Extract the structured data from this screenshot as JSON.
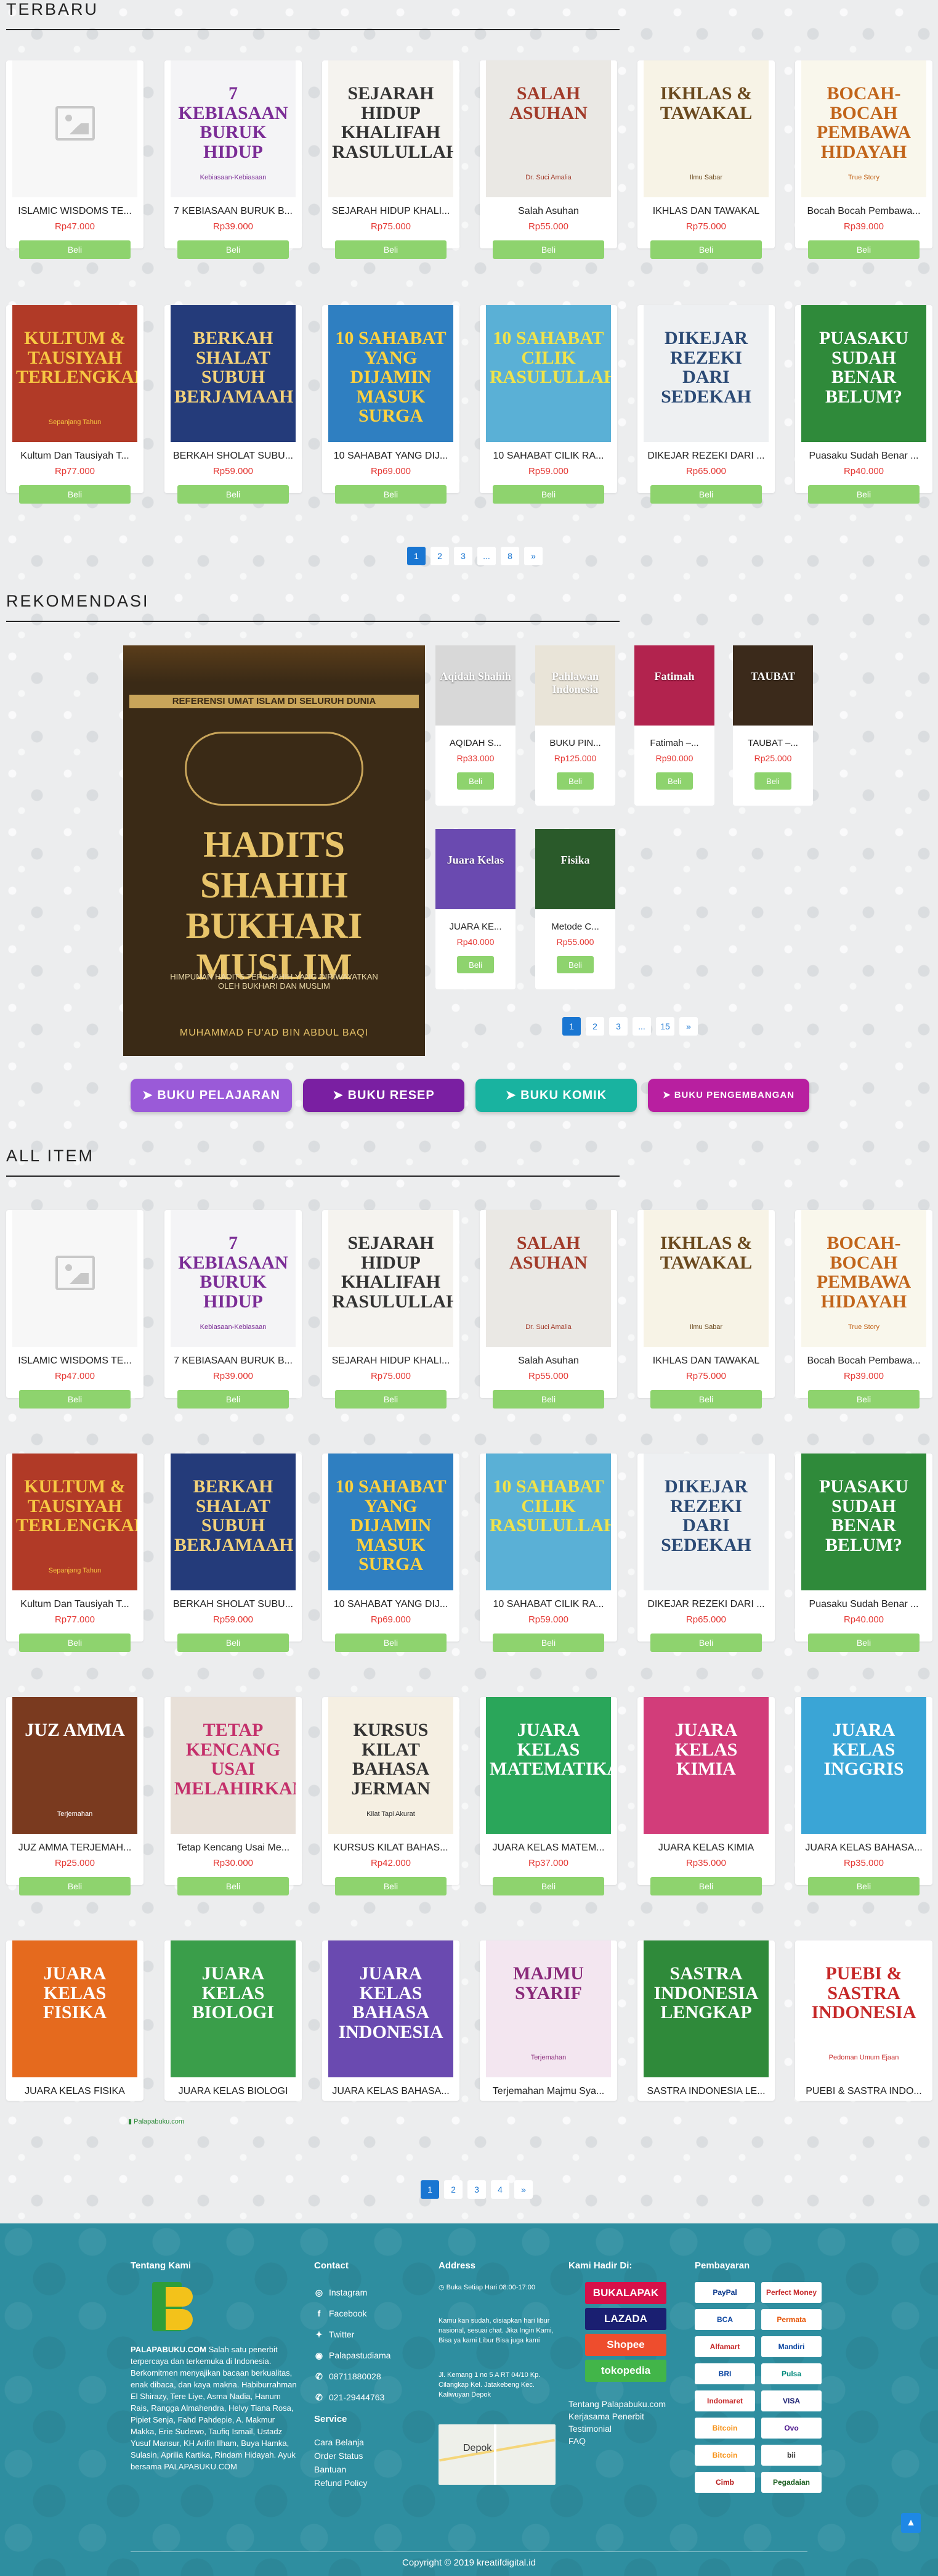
{
  "sections": {
    "newest": "TERBARU",
    "recommended": "REKOMENDASI",
    "all_items": "ALL ITEM"
  },
  "buy_label": "Beli",
  "books": [
    {
      "title": "ISLAMIC WISDOMS TE...",
      "price": "Rp47.000"
    },
    {
      "title": "7 KEBIASAAN BURUK B...",
      "price": "Rp39.000"
    },
    {
      "title": "SEJARAH HIDUP KHALI...",
      "price": "Rp75.000"
    },
    {
      "title": "Salah Asuhan",
      "price": "Rp55.000"
    },
    {
      "title": "IKHLAS DAN TAWAKAL",
      "price": "Rp75.000"
    },
    {
      "title": "Bocah Bocah Pembawa...",
      "price": "Rp39.000"
    },
    {
      "title": "Kultum Dan Tausiyah T...",
      "price": "Rp77.000"
    },
    {
      "title": "BERKAH SHOLAT SUBU...",
      "price": "Rp59.000"
    },
    {
      "title": "10 SAHABAT YANG DIJ...",
      "price": "Rp69.000"
    },
    {
      "title": "10 SAHABAT CILIK RA...",
      "price": "Rp59.000"
    },
    {
      "title": "DIKEJAR REZEKI DARI ...",
      "price": "Rp65.000"
    },
    {
      "title": "Puasaku Sudah Benar ...",
      "price": "Rp40.000"
    }
  ],
  "more_books": [
    {
      "title": "JUZ AMMA TERJEMAH...",
      "price": "Rp25.000"
    },
    {
      "title": "Tetap Kencang Usai Me...",
      "price": "Rp30.000"
    },
    {
      "title": "KURSUS KILAT BAHAS...",
      "price": "Rp42.000"
    },
    {
      "title": "JUARA KELAS MATEM...",
      "price": "Rp37.000"
    },
    {
      "title": "JUARA KELAS KIMIA",
      "price": "Rp35.000"
    },
    {
      "title": "JUARA KELAS BAHASA...",
      "price": "Rp35.000"
    },
    {
      "title": "JUARA KELAS FISIKA",
      "price": ""
    },
    {
      "title": "JUARA KELAS BIOLOGI",
      "price": ""
    },
    {
      "title": "JUARA KELAS BAHASA...",
      "price": ""
    },
    {
      "title": "Terjemahan Majmu Sya...",
      "price": ""
    },
    {
      "title": "SASTRA INDONESIA LE...",
      "price": ""
    },
    {
      "title": "PUEBI & SASTRA INDO...",
      "price": ""
    }
  ],
  "covers": [
    {
      "t": "",
      "s": "",
      "bg": "#f7f7f7",
      "fg": "#999",
      "ph": true
    },
    {
      "t": "7 kebiasaan buruk hidup",
      "s": "Kebiasaan-Kebiasaan",
      "bg": "#f4f4f6",
      "fg": "#7b2d96"
    },
    {
      "t": "Sejarah Hidup Khalifah Rasulullah",
      "s": "",
      "bg": "#f5f3ef",
      "fg": "#333"
    },
    {
      "t": "Salah Asuhan",
      "s": "Dr. Suci Amalia",
      "bg": "#eae8e4",
      "fg": "#a23b2a"
    },
    {
      "t": "Ikhlas & Tawakal",
      "s": "Ilmu Sabar",
      "bg": "#f7f3e6",
      "fg": "#6b4a1f"
    },
    {
      "t": "Bocah-Bocah Pembawa Hidayah",
      "s": "True Story",
      "bg": "#f9f7ec",
      "fg": "#c2651b"
    },
    {
      "t": "Kultum & Tausiyah Terlengkap",
      "s": "Sepanjang Tahun",
      "bg": "#b13a27",
      "fg": "#f7c843"
    },
    {
      "t": "Berkah Shalat Subuh Berjamaah",
      "s": "",
      "bg": "#243b7a",
      "fg": "#f3d27a"
    },
    {
      "t": "10 Sahabat yang Dijamin Masuk Surga",
      "s": "",
      "bg": "#2f7fc1",
      "fg": "#ffd23f"
    },
    {
      "t": "10 Sahabat Cilik Rasulullah",
      "s": "",
      "bg": "#5ab0d6",
      "fg": "#f0e34a"
    },
    {
      "t": "Dikejar Rezeki dari Sedekah",
      "s": "",
      "bg": "#eef0f2",
      "fg": "#2b4a75"
    },
    {
      "t": "Puasaku Sudah Benar Belum?",
      "s": "",
      "bg": "#2f8a3a",
      "fg": "#fff"
    }
  ],
  "more_covers": [
    {
      "t": "Juz Amma",
      "s": "Terjemahan",
      "bg": "#7a3a1f",
      "fg": "#fff"
    },
    {
      "t": "Tetap Kencang Usai Melahirkan",
      "s": "",
      "bg": "#e8e0d8",
      "fg": "#c4306b"
    },
    {
      "t": "Kursus Kilat Bahasa Jerman",
      "s": "Kilat Tapi Akurat",
      "bg": "#f5efe2",
      "fg": "#333"
    },
    {
      "t": "Juara Kelas Matematika",
      "s": "",
      "bg": "#2aa65a",
      "fg": "#fff"
    },
    {
      "t": "Juara Kelas Kimia",
      "s": "",
      "bg": "#d23d7a",
      "fg": "#fff"
    },
    {
      "t": "Juara Kelas Inggris",
      "s": "",
      "bg": "#3aa5d6",
      "fg": "#fff"
    },
    {
      "t": "Juara Kelas Fisika",
      "s": "",
      "bg": "#e56a1e",
      "fg": "#fff"
    },
    {
      "t": "Juara Kelas Biologi",
      "s": "",
      "bg": "#3a9e4a",
      "fg": "#fff"
    },
    {
      "t": "Juara Kelas Bahasa Indonesia",
      "s": "",
      "bg": "#6a4ab0",
      "fg": "#fff"
    },
    {
      "t": "Majmu Syarif",
      "s": "Terjemahan",
      "bg": "#f3e6f0",
      "fg": "#8a2a7a"
    },
    {
      "t": "Sastra Indonesia Lengkap",
      "s": "",
      "bg": "#2f8a3a",
      "fg": "#fff"
    },
    {
      "t": "PUEBI & Sastra Indonesia",
      "s": "Pedoman Umum Ejaan",
      "bg": "#fff",
      "fg": "#c62828"
    }
  ],
  "pagination_newest": [
    "1",
    "2",
    "3",
    "...",
    "8",
    "»"
  ],
  "pagination_rec": [
    "1",
    "2",
    "3",
    "...",
    "15",
    "»"
  ],
  "pagination_all": [
    "1",
    "2",
    "3",
    "4",
    "»"
  ],
  "recommend": {
    "feature": {
      "title": "HADITS SHAHIH BUKHARI MUSLIM",
      "top": "REFERENSI UMAT ISLAM DI SELURUH DUNIA",
      "sub": "HIMPUNAN HADITS TERSHAHIH YANG DIRIWAYATKAN OLEH BUKHARI DAN MUSLIM",
      "author": "MUHAMMAD FU'AD BIN ABDUL BAQI"
    },
    "items": [
      {
        "title": "AQIDAH S...",
        "price": "Rp33.000",
        "bg": "#d8d8d8",
        "cap": "Aqidah Shahih"
      },
      {
        "title": "BUKU PIN...",
        "price": "Rp125.000",
        "bg": "#e9e4d8",
        "cap": "Pahlawan Indonesia"
      },
      {
        "title": "Fatimah –...",
        "price": "Rp90.000",
        "bg": "#b2234e",
        "cap": "Fatimah"
      },
      {
        "title": "TAUBAT –...",
        "price": "Rp25.000",
        "bg": "#3b2a1b",
        "cap": "TAUBAT"
      },
      {
        "title": "JUARA KE...",
        "price": "Rp40.000",
        "bg": "#6a4ab0",
        "cap": "Juara Kelas"
      },
      {
        "title": "Metode C...",
        "price": "Rp55.000",
        "bg": "#2a5a2a",
        "cap": "Fisika"
      }
    ]
  },
  "categories": [
    {
      "label": "➤ BUKU PELAJARAN",
      "color": "#9a5ad8"
    },
    {
      "label": "➤ BUKU RESEP",
      "color": "#7a1fa2"
    },
    {
      "label": "➤ BUKU KOMIK",
      "color": "#19b3a0"
    },
    {
      "label": "➤ BUKU PENGEMBANGAN",
      "color": "#b81fa0"
    }
  ],
  "footer": {
    "about_head": "Tentang Kami",
    "about_brand": "PALAPABUKU.COM",
    "about_text": "Salah satu penerbit terpercaya dan terkemuka di Indonesia. Berkomitmen menyajikan bacaan berkualitas, enak dibaca, dan kaya makna. Habiburrahman El Shirazy, Tere Liye, Asma Nadia, Hanum Rais, Rangga Almahendra, Helvy Tiana Rosa, Pipiet Senja, Fahd Pahdepie, A. Makmur Makka, Erie Sudewo, Taufiq Ismail, Ustadz Yusuf Mansur, KH Arifin Ilham, Buya Hamka, Sulasin, Aprilia Kartika, Rindam Hidayah. Ayuk bersama PALAPABUKU.COM",
    "contact_head": "Contact",
    "contacts": [
      "Instagram",
      "Facebook",
      "Twitter",
      "Palapastudiama",
      "08711880028",
      "021-29444763"
    ],
    "service_head": "Service",
    "services": [
      "Cara Belanja",
      "Order Status",
      "Bantuan",
      "Refund Policy"
    ],
    "address_head": "Address",
    "hours": "Buka Setiap Hari 08:00-17:00",
    "address_note": "Kamu kan sudah, disiapkan hari libur nasional, sesuai chat. Jika Ingin Kami, Bisa ya kami Libur Bisa juga kami",
    "address": "Jl. Kemang 1 no 5 A RT 04/10 Kp. Cilangkap Kel. Jatakebeng Kec. Kaliwuyan Depok",
    "map_label": "Depok",
    "stores_head": "Kami Hadir Di:",
    "stores": [
      {
        "name": "BUKALAPAK",
        "color": "#d71149"
      },
      {
        "name": "LAZADA",
        "color": "#1a1f71"
      },
      {
        "name": "Shopee",
        "color": "#ee4d2d"
      },
      {
        "name": "tokopedia",
        "color": "#42b549"
      }
    ],
    "links": [
      "Tentang Palapabuku.com",
      "Kerjasama Penerbit",
      "Testimonial",
      "FAQ"
    ],
    "pay_head": "Pembayaran",
    "payments": [
      "PayPal",
      "Perfect Money",
      "BCA",
      "Permata",
      "Alfamart",
      "Mandiri",
      "BRI",
      "Pulsa",
      "Indomaret",
      "VISA",
      "Bitcoin",
      "Ovo",
      "Bitcoin",
      "bii",
      "Cimb",
      "Pegadaian"
    ],
    "copyright": "Copyright © 2019 kreatifdigital.id"
  }
}
